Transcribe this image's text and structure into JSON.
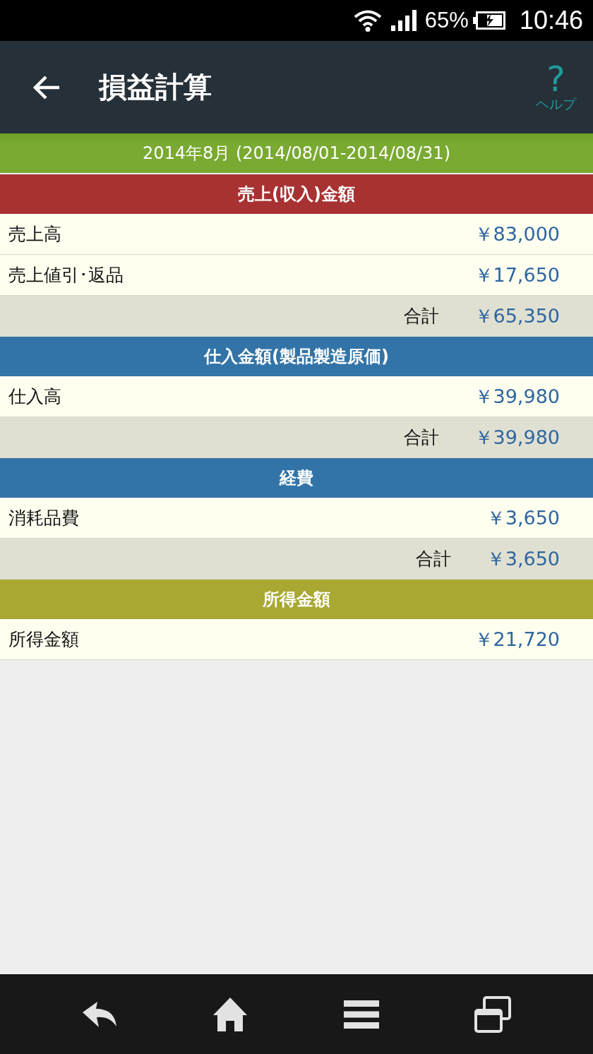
{
  "status_bar": {
    "battery": "65%",
    "time": "10:46"
  },
  "app_bar": {
    "title": "損益計算",
    "help_mark": "?",
    "help_label": "ヘルプ"
  },
  "period": "2014年8月 (2014/08/01-2014/08/31)",
  "sections": [
    {
      "title": "売上(収入)金額",
      "color": "#a83232",
      "rows": [
        {
          "kind": "item",
          "label": "売上高",
          "value": "￥83,000"
        },
        {
          "kind": "item",
          "label": "売上値引･返品",
          "value": "￥17,650"
        },
        {
          "kind": "total",
          "label": "合計",
          "value": "￥65,350"
        }
      ]
    },
    {
      "title": "仕入金額(製品製造原価)",
      "color": "#3274a8",
      "rows": [
        {
          "kind": "item",
          "label": "仕入高",
          "value": "￥39,980"
        },
        {
          "kind": "total",
          "label": "合計",
          "value": "￥39,980"
        }
      ]
    },
    {
      "title": "経費",
      "color": "#3274a8",
      "rows": [
        {
          "kind": "item",
          "label": "消耗品費",
          "value": "￥3,650"
        },
        {
          "kind": "total",
          "label": "合計",
          "value": "￥3,650"
        }
      ]
    },
    {
      "title": "所得金額",
      "color": "#a8a832",
      "rows": [
        {
          "kind": "item",
          "label": "所得金額",
          "value": "￥21,720"
        }
      ]
    }
  ]
}
